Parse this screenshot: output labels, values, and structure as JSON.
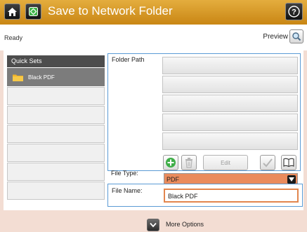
{
  "header": {
    "title": "Save to Network Folder",
    "icons": [
      "home-icon",
      "start-icon",
      "help-icon"
    ]
  },
  "status": {
    "text": "Ready",
    "preview_label": "Preview"
  },
  "quick_sets": {
    "header": "Quick Sets",
    "items": [
      {
        "label": "Black PDF",
        "selected": true
      },
      {
        "label": "",
        "selected": false
      },
      {
        "label": "",
        "selected": false
      },
      {
        "label": "",
        "selected": false
      },
      {
        "label": "",
        "selected": false
      },
      {
        "label": "",
        "selected": false
      },
      {
        "label": "",
        "selected": false
      }
    ]
  },
  "folder_path": {
    "label": "Folder Path",
    "rows": [
      "",
      "",
      "",
      "",
      ""
    ],
    "edit_label": "Edit",
    "tool_icons": [
      "add-icon",
      "delete-icon",
      "checkmark-icon",
      "address-book-icon"
    ]
  },
  "file_type": {
    "label": "File Type:",
    "value": "PDF"
  },
  "file_name": {
    "label": "File Name:",
    "value": "Black PDF"
  },
  "footer": {
    "more_options_label": "More Options"
  },
  "colors": {
    "title_bar": "#d99a2b",
    "accent_blue": "#5a9bd5",
    "orange": "#ea8b5c",
    "background": "#f3ddd3"
  }
}
